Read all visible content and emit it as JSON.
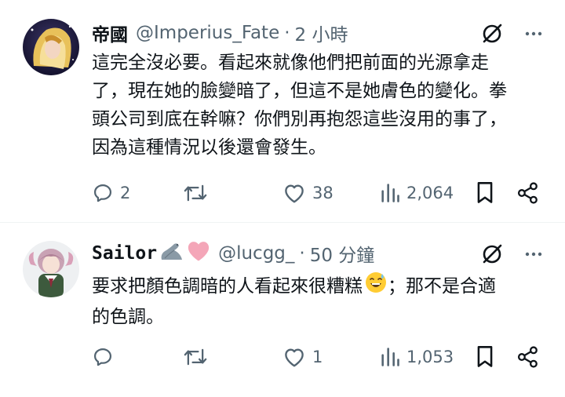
{
  "tweets": [
    {
      "display_name": "帝國",
      "handle": "@Imperius_Fate",
      "separator": "·",
      "time": "2 小時",
      "text": "這完全沒必要。看起來就像他們把前面的光源拿走了，現在她的臉變暗了，但這不是她膚色的變化。拳頭公司到底在幹嘛？你們別再抱怨這些沒用的事了，因為這種情況以後還會發生。",
      "text_lines": [
        "這完全沒必要。看起來就像他們把前面的光源拿走",
        "了，現在她的臉變暗了，但這不是她膚色的變化。拳",
        "頭公司到底在幹嘛？你們別再抱怨這些沒用的事了，",
        "因為這種情況以後還會發生。"
      ],
      "replies": "2",
      "retweets": "",
      "likes": "38",
      "views": "2,064"
    },
    {
      "display_name": "Sailor",
      "name_emojis": [
        "seal-emoji",
        "pink-heart-emoji"
      ],
      "handle": "@lucgg_",
      "separator": "·",
      "time": "50 分鐘",
      "text_part1": "要求把顏色調暗的人看起來很糟糕",
      "emoji": "sweat-smile-emoji",
      "text_part2": "；那不是合適",
      "text_line2": "的色調。",
      "replies": "",
      "retweets": "",
      "likes": "1",
      "views": "1,053"
    }
  ],
  "colors": {
    "text": "#0f1419",
    "secondary": "#536471",
    "divider": "#eff3f4",
    "heart_pink": "#f4a6b8"
  }
}
